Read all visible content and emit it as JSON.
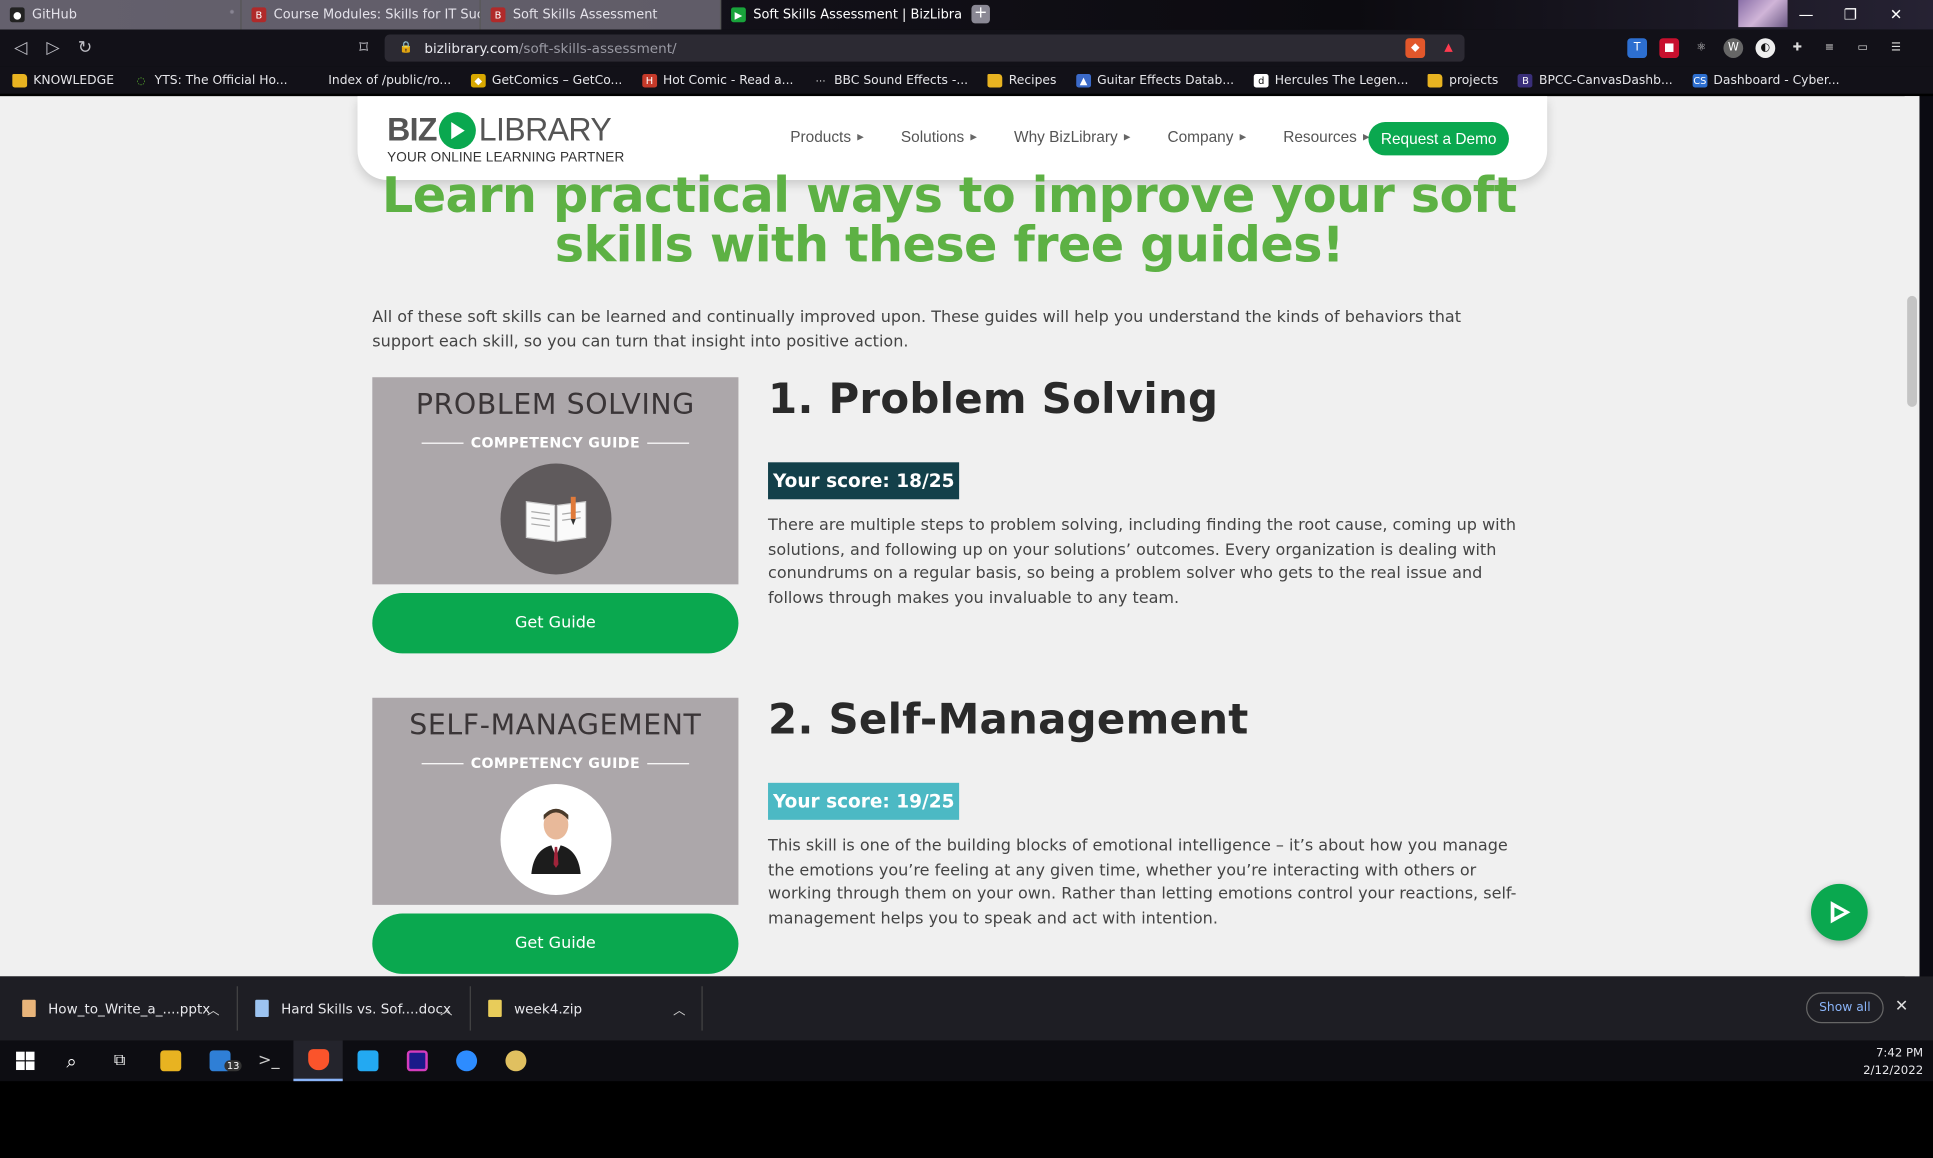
{
  "browser": {
    "tabs": [
      {
        "label": "GitHub",
        "icon": "github-icon"
      },
      {
        "label": "Course Modules: Skills for IT Success",
        "icon": "bizlibrary-icon"
      },
      {
        "label": "Soft Skills Assessment",
        "icon": "bizlibrary-icon"
      },
      {
        "label": "Soft Skills Assessment | BizLibrary",
        "icon": "play-icon",
        "active": true
      }
    ],
    "new_tab_glyph": "+",
    "url_domain": "bizlibrary.com",
    "url_path": "/soft-skills-assessment/",
    "bookmarks": [
      {
        "label": "KNOWLEDGE",
        "icon": "folder-icon"
      },
      {
        "label": "YTS: The Official Ho...",
        "icon": "yts-icon"
      },
      {
        "label": "Index of /public/ro...",
        "icon": "blank-icon"
      },
      {
        "label": "GetComics – GetCo...",
        "icon": "getcomics-icon"
      },
      {
        "label": "Hot Comic - Read a...",
        "icon": "hotcomic-icon"
      },
      {
        "label": "BBC Sound Effects -...",
        "icon": "bbc-icon"
      },
      {
        "label": "Recipes",
        "icon": "folder-icon"
      },
      {
        "label": "Guitar Effects Datab...",
        "icon": "guitar-icon"
      },
      {
        "label": "Hercules The Legen...",
        "icon": "d-icon"
      },
      {
        "label": "projects",
        "icon": "folder-icon"
      },
      {
        "label": "BPCC-CanvasDashb...",
        "icon": "canvas-icon"
      },
      {
        "label": "Dashboard - Cyber...",
        "icon": "cs-icon"
      }
    ]
  },
  "site": {
    "logo_word1": "BIZ",
    "logo_word2": "LIBRARY",
    "tagline": "YOUR ONLINE LEARNING PARTNER",
    "nav": [
      "Products",
      "Solutions",
      "Why BizLibrary",
      "Company",
      "Resources"
    ],
    "cta": "Request a Demo",
    "headline_line1": "Learn practical ways to improve your soft",
    "headline_line2": "skills with these free guides!",
    "intro": "All of these soft skills can be learned and continually improved upon. These guides will help you understand the kinds of behaviors that support each skill, so you can turn that insight into positive action."
  },
  "guides": [
    {
      "card_title": "PROBLEM SOLVING",
      "card_subtitle": "COMPETENCY GUIDE",
      "button": "Get Guide",
      "title": "1. Problem Solving",
      "score": "Your score: 18/25",
      "score_color": "#13404a",
      "description": "There are multiple steps to problem solving, including finding the root cause, coming up with solutions, and following up on your solutions’ outcomes. Every organization is dealing with conundrums on a regular basis, so being a problem solver who gets to the real issue and follows through makes you invaluable to any team."
    },
    {
      "card_title": "SELF-MANAGEMENT",
      "card_subtitle": "COMPETENCY GUIDE",
      "button": "Get Guide",
      "title": "2. Self-Management",
      "score": "Your score: 19/25",
      "score_color": "#4cb9c4",
      "description": "This skill is one of the building blocks of emotional intelligence – it’s about how you manage the emotions you’re feeling at any given time, whether you’re interacting with others or working through them on your own. Rather than letting emotions control your reactions, self-management helps you to speak and act with intention."
    }
  ],
  "downloads": {
    "items": [
      "How_to_Write_a_....pptx",
      "Hard Skills vs. Sof....docx",
      "week4.zip"
    ],
    "show_all": "Show all"
  },
  "taskbar": {
    "mail_badge": "13",
    "time": "7:42 PM",
    "date": "2/12/2022"
  },
  "colors": {
    "brand_green": "#0aa84f",
    "headline_green": "#5db144"
  }
}
